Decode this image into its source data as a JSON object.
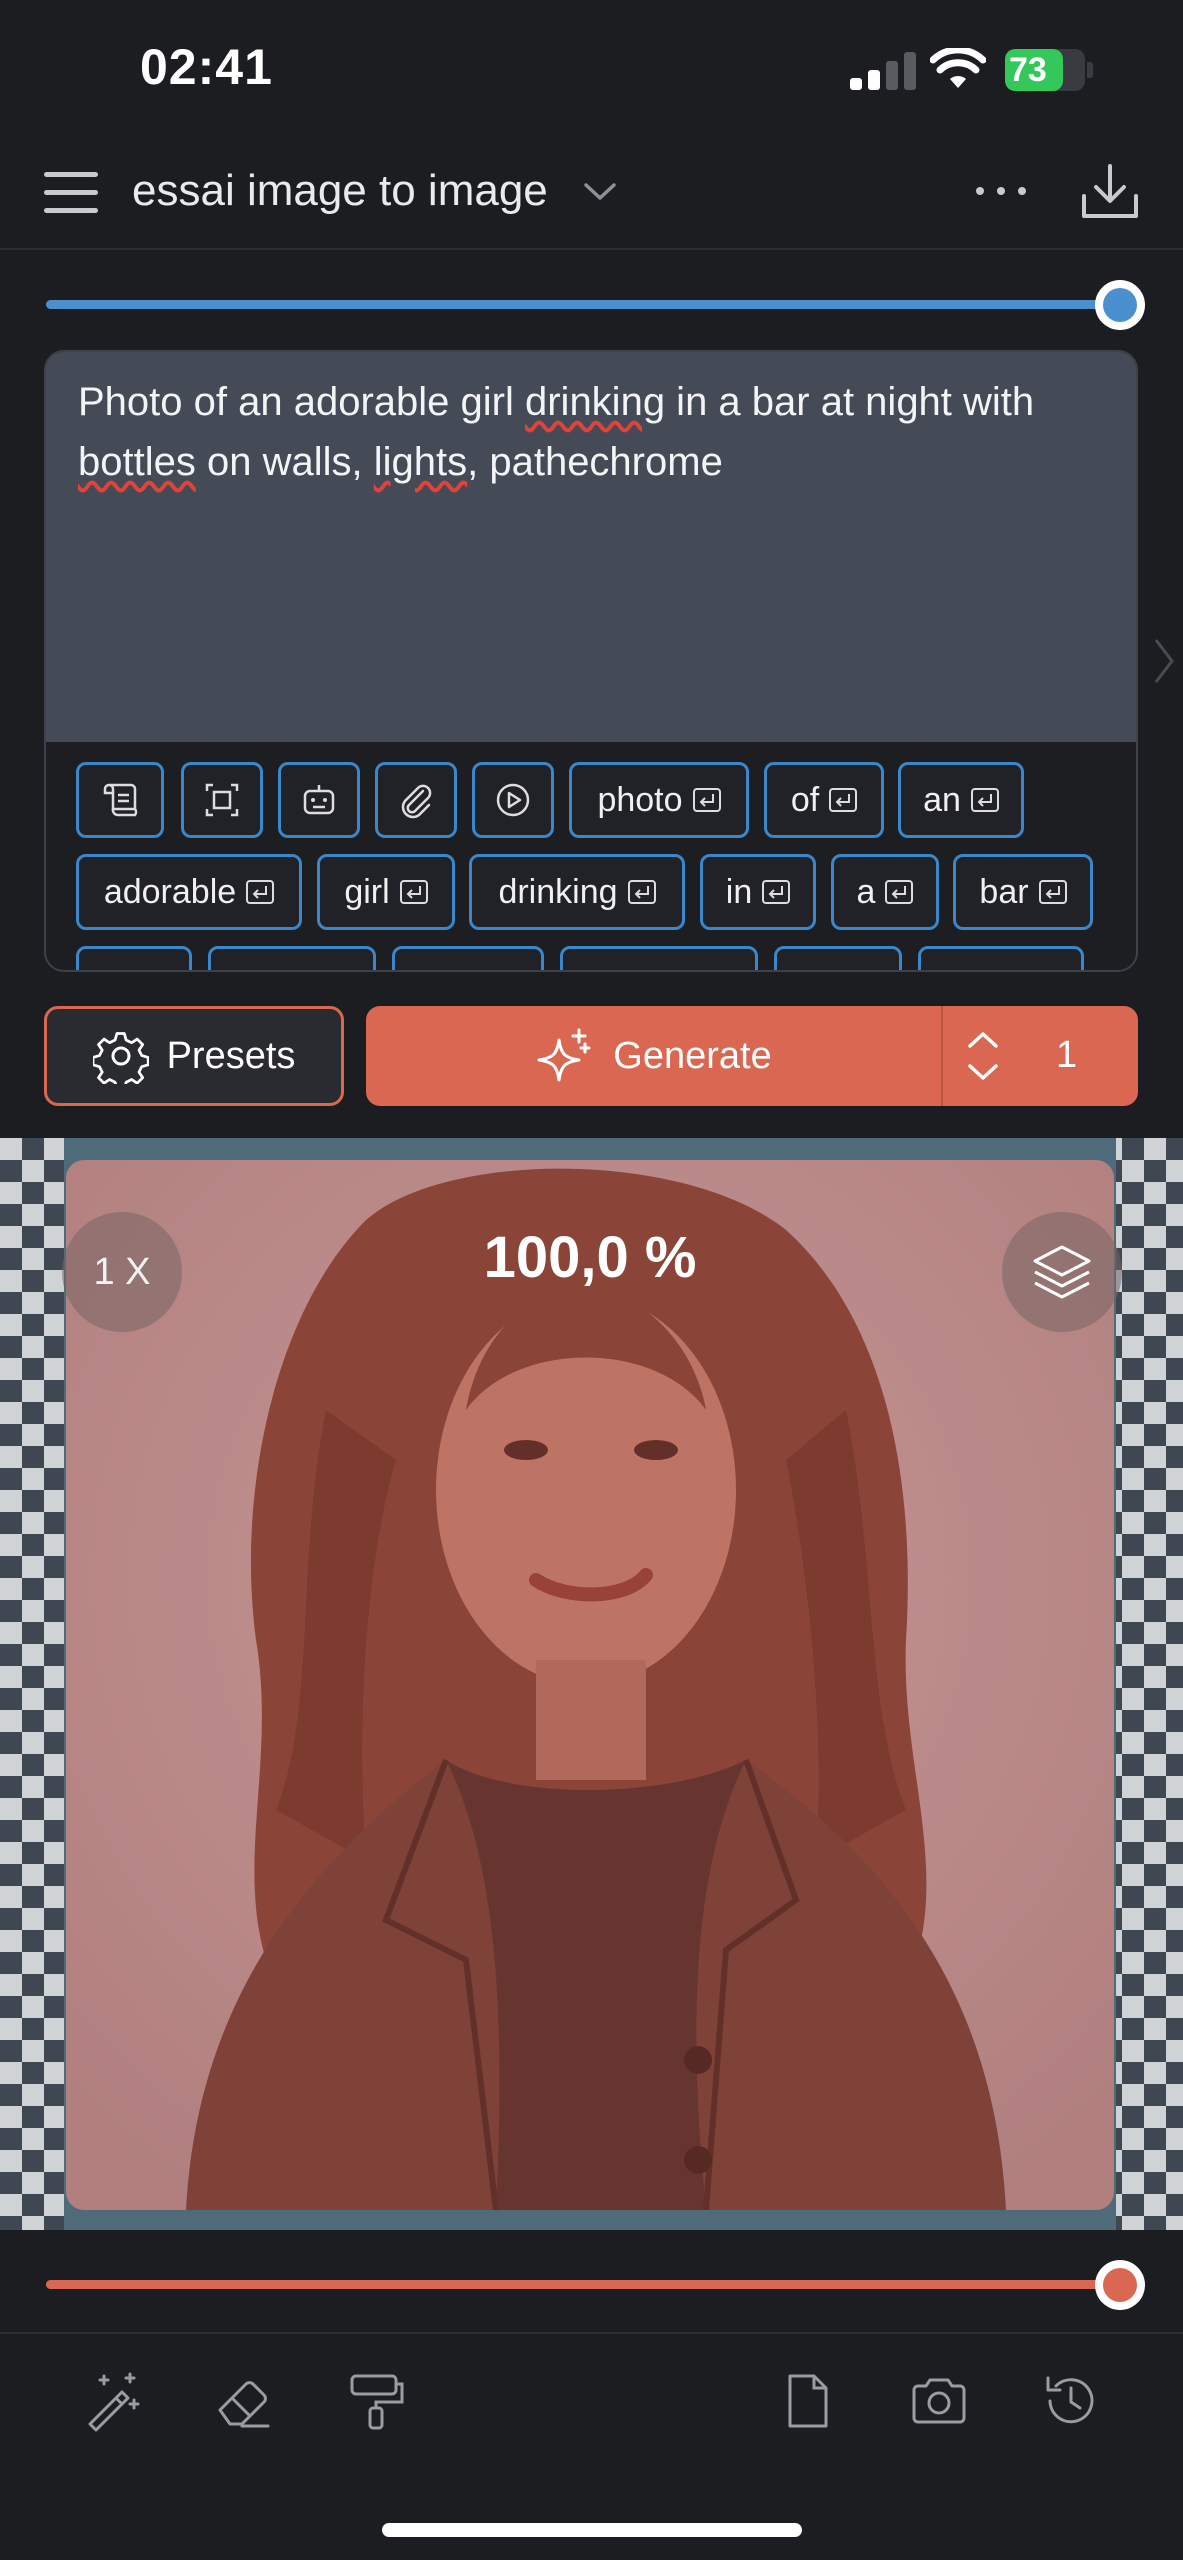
{
  "status_bar": {
    "time": "02:41",
    "battery_percent": "73",
    "battery_level": 0.73,
    "colors": {
      "battery": "#34c759"
    }
  },
  "header": {
    "title": "essai image to image",
    "menu_icon": "hamburger-icon",
    "title_dropdown_icon": "chevron-down-icon",
    "more_icon": "ellipsis-icon",
    "download_icon": "download-icon"
  },
  "top_slider": {
    "value": 1.0,
    "color": "#4a90cf"
  },
  "prompt": {
    "text_parts": [
      {
        "t": "Photo of an adorable girl ",
        "spell": false
      },
      {
        "t": "drinking",
        "spell": true
      },
      {
        "t": " in a bar at night with ",
        "spell": false
      },
      {
        "t": "bottles",
        "spell": true
      },
      {
        "t": " on walls, ",
        "spell": false
      },
      {
        "t": "lights",
        "spell": true
      },
      {
        "t": ", pathechrome",
        "spell": false
      }
    ]
  },
  "token_tools": [
    "scroll-icon",
    "select-frame-icon",
    "robot-icon",
    "paperclip-icon",
    "play-icon"
  ],
  "tokens_row1": [
    "photo",
    "of",
    "an"
  ],
  "tokens_row2": [
    "adorable",
    "girl",
    "drinking",
    "in",
    "a",
    "bar"
  ],
  "actions": {
    "presets_label": "Presets",
    "generate_label": "Generate",
    "count": "1",
    "colors": {
      "accent": "#d96751"
    }
  },
  "canvas": {
    "progress_text": "100,0 %",
    "zoom_label": "1 X"
  },
  "bottom_slider": {
    "value": 1.0,
    "color": "#d96751"
  },
  "toolbar": {
    "icons": [
      "magic-wand-icon",
      "eraser-icon",
      "paint-roller-icon",
      "document-icon",
      "camera-icon",
      "history-icon"
    ]
  }
}
